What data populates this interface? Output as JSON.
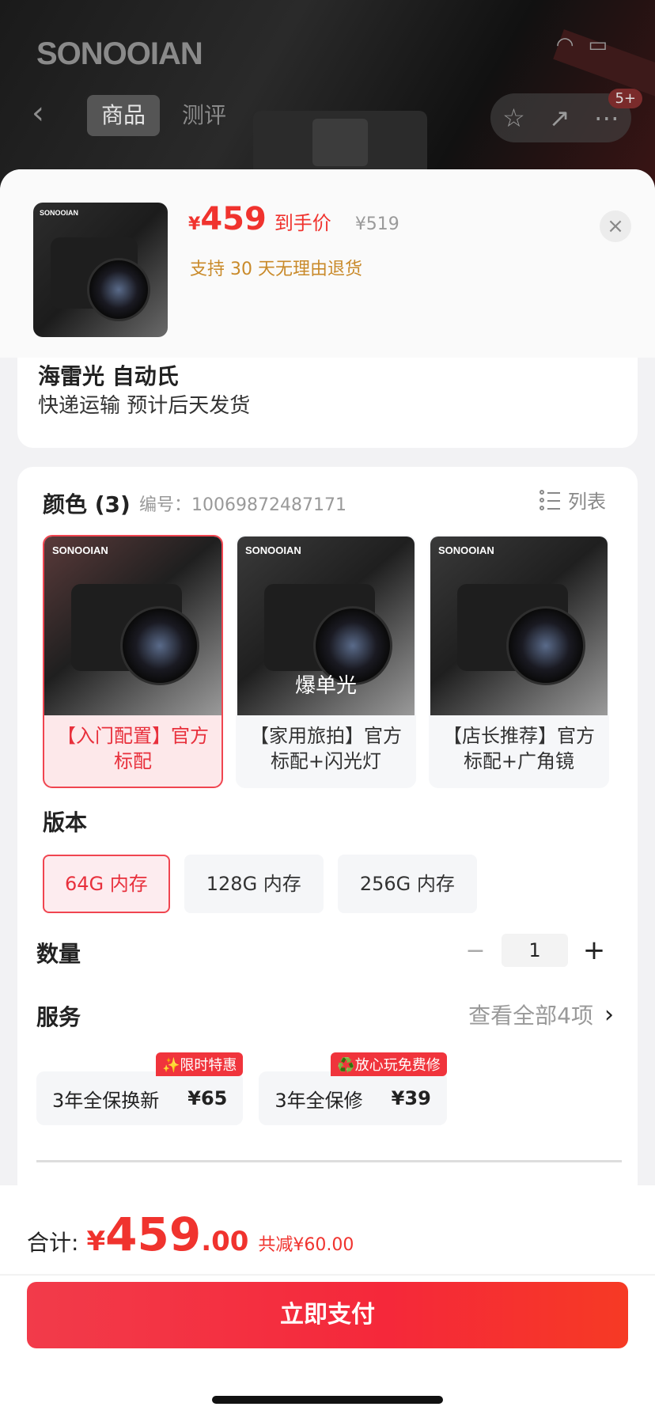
{
  "top": {
    "brand": "SONOOIAN",
    "tabs": [
      "商品",
      "测评"
    ],
    "badge": "5+"
  },
  "sku_header": {
    "price_yen": "¥",
    "price": "459",
    "price_tag": "到手价",
    "old_price": "¥519",
    "return_policy": "支持 30 天无理由退货",
    "thumb_brand": "SONOOIAN"
  },
  "shipping": {
    "cut_off_line": "海雷光  自动氏",
    "text": "快递运输 预计后天发货"
  },
  "color_section": {
    "title": "颜色 (3)",
    "sku_label": "编号：10069872487171",
    "list_label": "列表",
    "options": [
      {
        "brand": "SONOOIAN",
        "label": "【入门配置】官方标配",
        "overlay": ""
      },
      {
        "brand": "SONOOIAN",
        "label": "【家用旅拍】官方标配+闪光灯",
        "overlay": "爆单光"
      },
      {
        "brand": "SONOOIAN",
        "label": "【店长推荐】官方标配+广角镜",
        "overlay": ""
      }
    ]
  },
  "version_section": {
    "title": "版本",
    "options": [
      "64G 内存",
      "128G 内存",
      "256G 内存"
    ]
  },
  "quantity": {
    "title": "数量",
    "value": "1",
    "minus": "−",
    "plus": "+"
  },
  "service": {
    "title": "服务",
    "view_all": "查看全部4项",
    "items": [
      {
        "name": "3年全保换新",
        "price": "¥65",
        "badge": "✨限时特惠"
      },
      {
        "name": "3年全保修",
        "price": "¥39",
        "badge": "♻️放心玩免费修"
      }
    ]
  },
  "bottom": {
    "total_label": "合计:",
    "total_yen": "¥",
    "total_int": "459",
    "total_dec": ".00",
    "total_save": "共减¥60.00",
    "pay_label": "立即支付"
  },
  "colors": {
    "accent": "#f0332e",
    "selected_border": "#f04550",
    "gold": "#c98a2a"
  }
}
